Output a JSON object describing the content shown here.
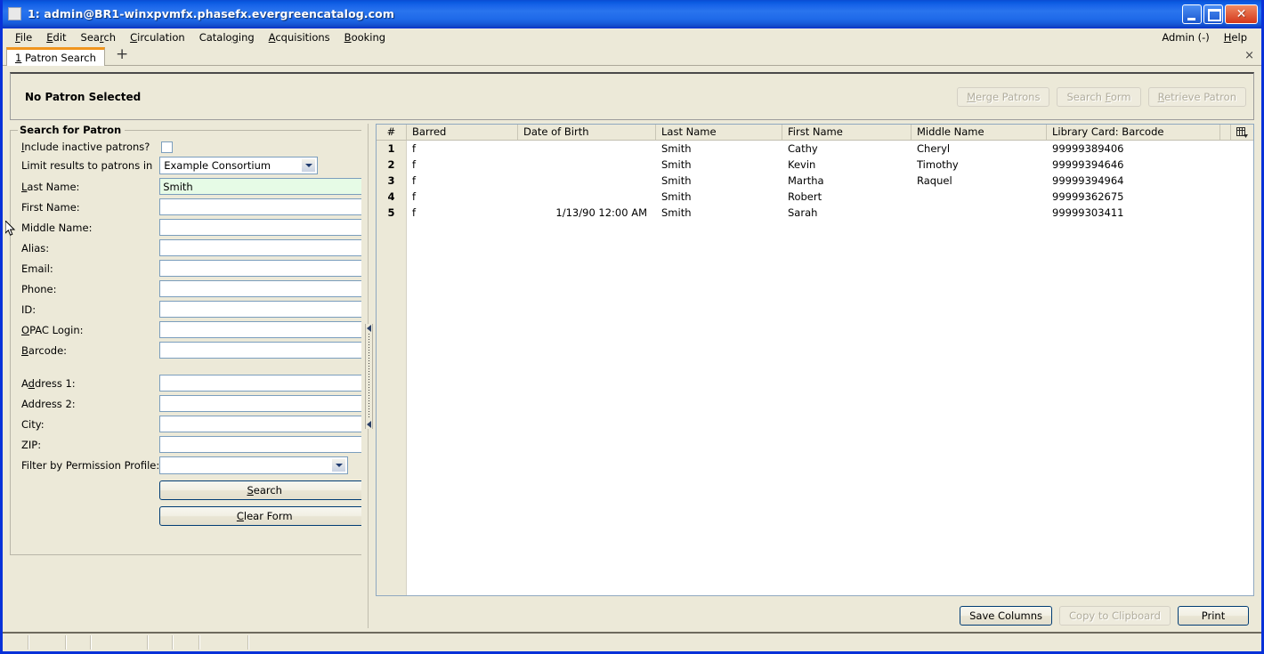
{
  "window": {
    "title": "1: admin@BR1-winxpvmfx.phasefx.evergreencatalog.com",
    "minimize_label": "_",
    "maximize_label": "",
    "close_label": "✕"
  },
  "menubar": {
    "items": [
      {
        "label": "File",
        "accel": "F"
      },
      {
        "label": "Edit",
        "accel": "E"
      },
      {
        "label": "Search",
        "accel": "r"
      },
      {
        "label": "Circulation",
        "accel": "C"
      },
      {
        "label": "Cataloging",
        "accel": "g"
      },
      {
        "label": "Acquisitions",
        "accel": "A"
      },
      {
        "label": "Booking",
        "accel": "B"
      }
    ],
    "right": [
      {
        "label": "Admin (-)"
      },
      {
        "label": "Help",
        "accel": "H"
      }
    ]
  },
  "tabstrip": {
    "tabs": [
      {
        "label": "1 Patron Search"
      }
    ],
    "add_label": "+",
    "close_label": "×"
  },
  "patron_header": {
    "title": "No Patron Selected",
    "buttons": [
      {
        "label": "Merge Patrons",
        "enabled": false
      },
      {
        "label": "Search Form",
        "enabled": false
      },
      {
        "label": "Retrieve Patron",
        "enabled": false
      }
    ]
  },
  "search_form": {
    "legend": "Search for Patron",
    "include_inactive_label": "Include inactive patrons?",
    "include_inactive_checked": false,
    "limit_results_label": "Limit results to patrons in",
    "limit_results_value": "Example Consortium",
    "fields": [
      {
        "label": "Last Name:",
        "value": "Smith",
        "active": true
      },
      {
        "label": "First Name:",
        "value": "",
        "active": false
      },
      {
        "label": "Middle Name:",
        "value": "",
        "active": false
      },
      {
        "label": "Alias:",
        "value": "",
        "active": false
      },
      {
        "label": "Email:",
        "value": "",
        "active": false
      },
      {
        "label": "Phone:",
        "value": "",
        "active": false
      },
      {
        "label": "ID:",
        "value": "",
        "active": false
      },
      {
        "label": "OPAC Login:",
        "value": "",
        "active": false
      },
      {
        "label": "Barcode:",
        "value": "",
        "active": false
      }
    ],
    "address_fields": [
      {
        "label": "Address 1:",
        "value": ""
      },
      {
        "label": "Address 2:",
        "value": ""
      },
      {
        "label": "City:",
        "value": ""
      },
      {
        "label": "ZIP:",
        "value": ""
      }
    ],
    "permission_profile_label": "Filter by Permission Profile:",
    "permission_profile_value": "",
    "search_button": "Search",
    "clear_button": "Clear Form"
  },
  "results": {
    "columns": [
      {
        "key": "num",
        "label": "#"
      },
      {
        "key": "barred",
        "label": "Barred"
      },
      {
        "key": "dob",
        "label": "Date of Birth"
      },
      {
        "key": "last",
        "label": "Last Name"
      },
      {
        "key": "first",
        "label": "First Name"
      },
      {
        "key": "middle",
        "label": "Middle Name"
      },
      {
        "key": "card",
        "label": "Library Card: Barcode"
      }
    ],
    "column_picker_icon": "column-picker-icon",
    "rows": [
      {
        "num": "1",
        "barred": "f",
        "dob": "",
        "last": "Smith",
        "first": "Cathy",
        "middle": "Cheryl",
        "card": "99999389406"
      },
      {
        "num": "2",
        "barred": "f",
        "dob": "",
        "last": "Smith",
        "first": "Kevin",
        "middle": "Timothy",
        "card": "99999394646"
      },
      {
        "num": "3",
        "barred": "f",
        "dob": "",
        "last": "Smith",
        "first": "Martha",
        "middle": "Raquel",
        "card": "99999394964"
      },
      {
        "num": "4",
        "barred": "f",
        "dob": "",
        "last": "Smith",
        "first": "Robert",
        "middle": "",
        "card": "99999362675"
      },
      {
        "num": "5",
        "barred": "f",
        "dob": "1/13/90 12:00 AM",
        "last": "Smith",
        "first": "Sarah",
        "middle": "",
        "card": "99999303411"
      }
    ],
    "footer_buttons": [
      {
        "label": "Save Columns",
        "enabled": true
      },
      {
        "label": "Copy to Clipboard",
        "enabled": false
      },
      {
        "label": "Print",
        "enabled": true
      }
    ]
  },
  "colors": {
    "title_blue": "#0831d9",
    "client_beige": "#ece9d8",
    "active_field_green": "#e6fbe6",
    "tab_accent_orange": "#f0951e",
    "field_border_blue": "#7b9ebd"
  }
}
